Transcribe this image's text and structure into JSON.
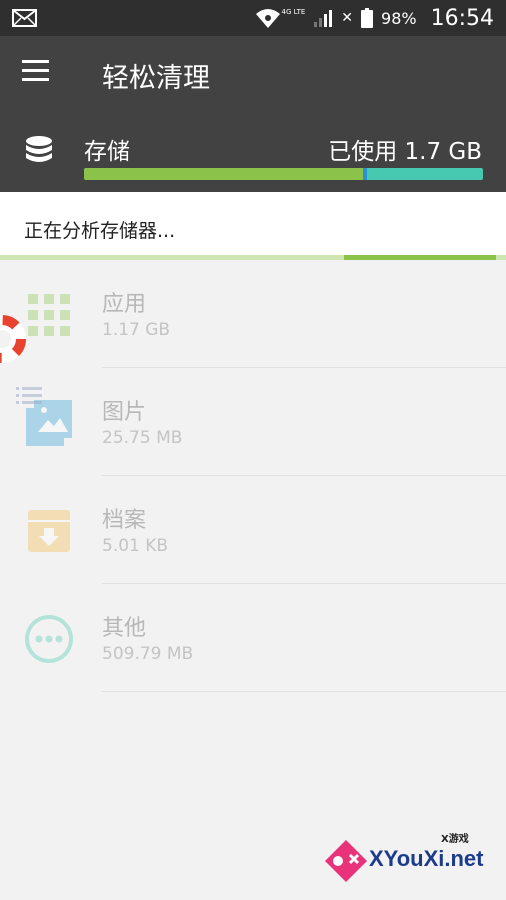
{
  "status_bar": {
    "network_label": "4G LTE",
    "battery_percent": "98%",
    "time": "16:54",
    "icons": [
      "mail-icon",
      "wifi-icon",
      "signal-icon",
      "no-signal-icon",
      "battery-icon"
    ]
  },
  "toolbar": {
    "menu_icon": "hamburger-menu-icon",
    "title": "轻松清理"
  },
  "storage": {
    "label": "存储",
    "used_text": "已使用 1.7 GB",
    "used_fraction": 0.7,
    "icon": "database-icon",
    "colors": {
      "used": "#8bc34a",
      "free": "#46c9b0",
      "marker": "#2b8fd1"
    }
  },
  "analyze": {
    "status_text": "正在分析存储器...",
    "progress_start": 0.68,
    "progress_end": 0.98
  },
  "categories": [
    {
      "name": "应用",
      "size": "1.17 GB",
      "icon": "apps-grid-icon",
      "color": "#8bc34a"
    },
    {
      "name": "图片",
      "size": "25.75 MB",
      "icon": "image-icon",
      "color": "#2a9fd6"
    },
    {
      "name": "档案",
      "size": "5.01 KB",
      "icon": "archive-box-icon",
      "color": "#f5b942"
    },
    {
      "name": "其他",
      "size": "509.79 MB",
      "icon": "more-dots-icon",
      "color": "#46c9b0"
    }
  ],
  "overlays": {
    "lifebuoy_icon": "lifebuoy-icon",
    "list_icon": "floating-list-icon"
  },
  "watermark": {
    "tagline": "X游戏",
    "site": "XYouXi.net"
  }
}
